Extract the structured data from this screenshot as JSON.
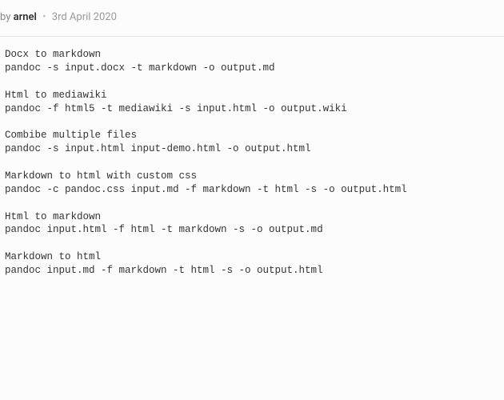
{
  "byline": {
    "by_prefix": "by ",
    "author": "arnel",
    "bullet": "•",
    "date": "3rd April 2020"
  },
  "code": {
    "content": "Docx to markdown\npandoc -s input.docx -t markdown -o output.md\n\nHtml to mediawiki\npandoc -f html5 -t mediawiki -s input.html -o output.wiki\n\nCombibe multiple files\npandoc -s input.html input-demo.html -o output.html\n\nMarkdown to html with custom css\npandoc -c pandoc.css input.md -f markdown -t html -s -o output.html\n\nHtml to markdown\npandoc input.html -f html -t markdown -s -o output.md\n\nMarkdown to html\npandoc input.md -f markdown -t html -s -o output.html"
  }
}
